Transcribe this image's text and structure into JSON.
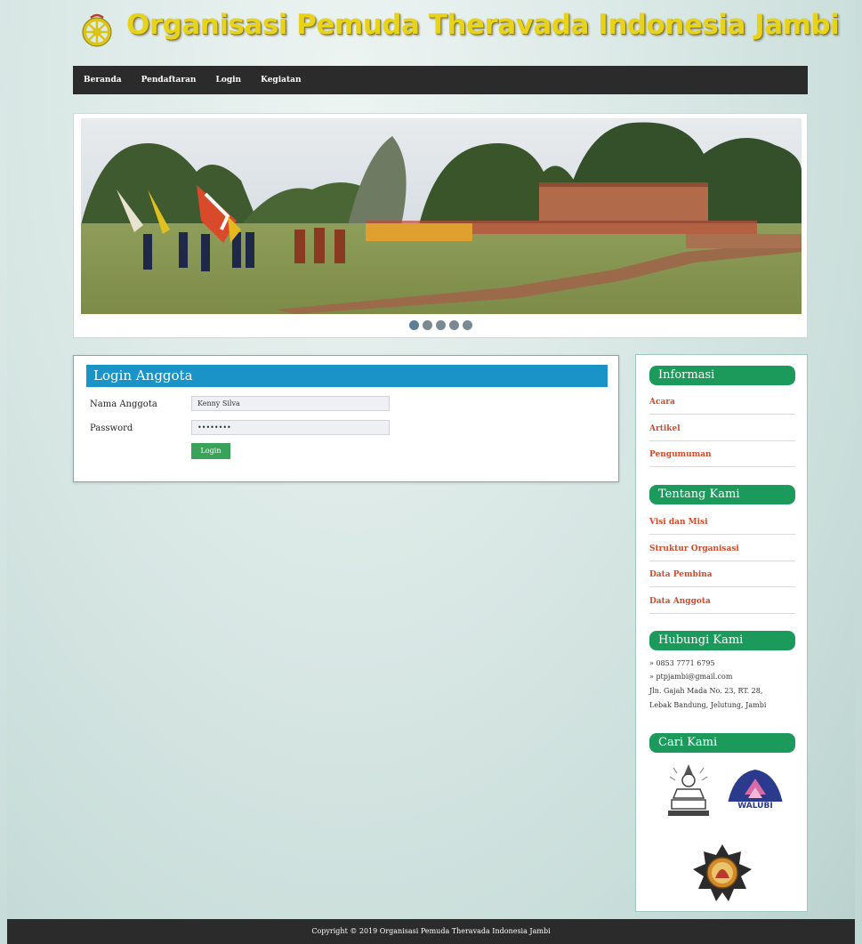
{
  "header": {
    "title": "Organisasi Pemuda Theravada Indonesia Jambi",
    "logo": "dharma-wheel-logo"
  },
  "nav": {
    "items": [
      "Beranda",
      "Pendaftaran",
      "Login",
      "Kegiatan"
    ]
  },
  "slider": {
    "dot_count": 5,
    "active_index": 0
  },
  "login": {
    "title": "Login Anggota",
    "name_label": "Nama Anggota",
    "name_value": "Kenny Silva",
    "password_label": "Password",
    "password_value": "••••••••",
    "button_label": "Login"
  },
  "sidebar": {
    "info_title": "Informasi",
    "info_links": [
      "Acara",
      "Artikel",
      "Pengumuman"
    ],
    "about_title": "Tentang Kami",
    "about_links": [
      "Visi dan Misi",
      "Struktur Organisasi",
      "Data Pembina",
      "Data Anggota"
    ],
    "contact_title": "Hubungi Kami",
    "contact_lines": [
      "» 0853 7771 6795",
      "» ptpjambi@gmail.com",
      "Jln. Gajah Mada No. 23, RT. 28,",
      "Lebak Bandung, Jelutung, Jambi"
    ],
    "find_title": "Cari Kami",
    "partner_text": "WALUBI"
  },
  "footer": {
    "copyright": "Copyright © 2019 Organisasi Pemuda Theravada Indonesia Jambi"
  },
  "colors": {
    "nav_bg": "#2b2b2b",
    "login_header": "#1a93c6",
    "sidebar_head": "#1b9a5c",
    "link": "#d24a2a",
    "title_yellow": "#e7d21c",
    "button_green": "#3aa35a"
  }
}
